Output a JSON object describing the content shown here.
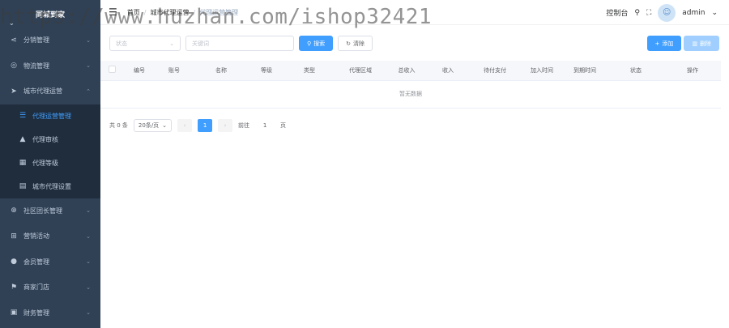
{
  "sidebar": {
    "brand": "同城到家",
    "items": [
      {
        "label": "分销管理",
        "icon": "share-icon"
      },
      {
        "label": "物流管理",
        "icon": "globe-icon"
      },
      {
        "label": "城市代理运营",
        "icon": "send-icon",
        "expanded": true
      },
      {
        "label": "社区团长管理",
        "icon": "plus-circle-icon"
      },
      {
        "label": "营销活动",
        "icon": "gift-icon"
      },
      {
        "label": "会员管理",
        "icon": "user-icon"
      },
      {
        "label": "商家门店",
        "icon": "flag-icon"
      },
      {
        "label": "财务管理",
        "icon": "wallet-icon"
      }
    ],
    "subitems": [
      {
        "label": "代理运营管理",
        "icon": "list-icon",
        "active": true
      },
      {
        "label": "代理审核",
        "icon": "user-check-icon"
      },
      {
        "label": "代理等级",
        "icon": "grid-icon"
      },
      {
        "label": "城市代理设置",
        "icon": "doc-icon"
      }
    ]
  },
  "header": {
    "breadcrumb": [
      "首页",
      "城市代理运营",
      "代理运营管理"
    ],
    "console": "控制台",
    "user": "admin"
  },
  "watermark": "https://www.huzhan.com/ishop32421",
  "filters": {
    "status_placeholder": "状态",
    "keyword_placeholder": "关键词",
    "search": "搜索",
    "reset": "清除"
  },
  "actions": {
    "add": "添加",
    "delete": "删除"
  },
  "table": {
    "columns": [
      "编号",
      "账号",
      "名称",
      "等级",
      "类型",
      "代理区域",
      "总收入",
      "收入",
      "待付支付",
      "加入时间",
      "到期时间",
      "状态",
      "操作"
    ],
    "empty": "暂无数据"
  },
  "pager": {
    "total": "共 0 条",
    "size": "20条/页",
    "page": "1",
    "goto": "前往",
    "goto_value": "1",
    "page_unit": "页"
  },
  "colors": {
    "sidebar": "#304156",
    "accent": "#409eff"
  }
}
